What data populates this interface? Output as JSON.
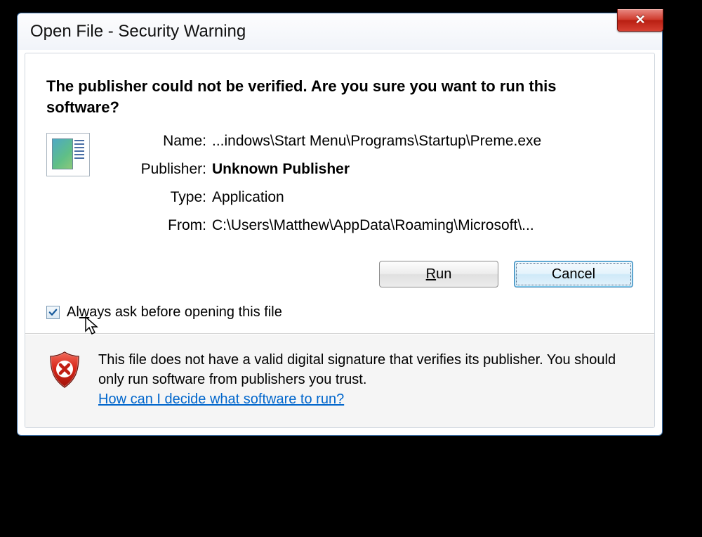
{
  "dialog": {
    "title": "Open File - Security Warning",
    "heading": "The publisher could not be verified.  Are you sure you want to run this software?",
    "fields": {
      "name_label": "Name:",
      "name_value": "...indows\\Start Menu\\Programs\\Startup\\Preme.exe",
      "publisher_label": "Publisher:",
      "publisher_value": "Unknown Publisher",
      "type_label": "Type:",
      "type_value": "Application",
      "from_label": "From:",
      "from_value": "C:\\Users\\Matthew\\AppData\\Roaming\\Microsoft\\..."
    },
    "buttons": {
      "run": "Run",
      "cancel": "Cancel"
    },
    "checkbox": {
      "checked": true,
      "label_pre": "Al",
      "label_u": "w",
      "label_post": "ays ask before opening this file"
    },
    "footer": {
      "text": "This file does not have a valid digital signature that verifies its publisher.  You should only run software from publishers you trust.",
      "link": "How can I decide what software to run?"
    }
  }
}
